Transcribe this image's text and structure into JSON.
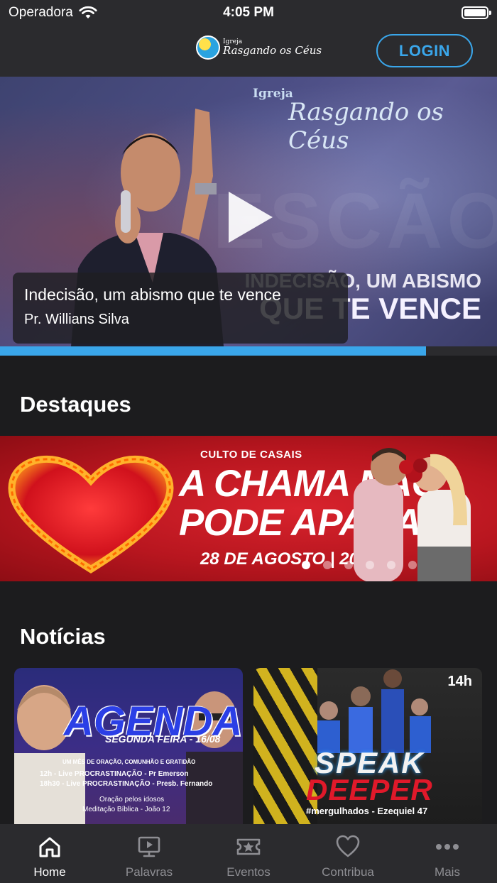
{
  "status_bar": {
    "carrier": "Operadora",
    "time": "4:05 PM"
  },
  "header": {
    "logo_small": "Igreja",
    "logo_script": "Rasgando os Céus",
    "login_label": "LOGIN"
  },
  "hero": {
    "brand_small": "Igreja",
    "brand_script": "Rasgando os Céus",
    "art_line1": "INDECISÃO, UM ABISMO",
    "art_line2": "QUE TE VENCE",
    "caption_title": "Indecisão, um abismo que te vence",
    "caption_subtitle": "Pr. Willians Silva",
    "progress_fraction": 0.857
  },
  "sections": {
    "highlights_title": "Destaques",
    "news_title": "Notícias"
  },
  "banner": {
    "small_text": "CULTO DE CASAIS",
    "big_line1": "A CHAMA NÃO",
    "big_line2": "PODE APAGAR",
    "date": "28 DE AGOSTO | 20h",
    "dots_total": 6,
    "dots_active_index": 0
  },
  "news": [
    {
      "agenda": "AGENDA",
      "date": "SEGUNDA FEIRA - 16/08",
      "subtitle": "UM MÊS DE ORAÇÃO, COMUNHÃO E GRATIDÃO",
      "line1": "12h - Live PROCRASTINAÇÃO - Pr Emerson",
      "line2": "18h30 - Live PROCRASTINAÇÃO - Presb. Fernando",
      "line3": "Oração pelos idosos",
      "line4": "Meditação Bíblica - João 12"
    },
    {
      "time": "14h",
      "word1": "SPEAK",
      "word2": "DEEPER",
      "tag": "#mergulhados - Ezequiel 47"
    }
  ],
  "tabbar": {
    "tabs": [
      {
        "label": "Home",
        "icon": "home-icon",
        "active": true
      },
      {
        "label": "Palavras",
        "icon": "video-icon",
        "active": false
      },
      {
        "label": "Eventos",
        "icon": "ticket-star-icon",
        "active": false
      },
      {
        "label": "Contribua",
        "icon": "heart-icon",
        "active": false
      },
      {
        "label": "Mais",
        "icon": "more-icon",
        "active": false
      }
    ]
  },
  "colors": {
    "accent": "#3aa6ea",
    "background": "#1c1c1e",
    "bar": "#2b2b2e",
    "inactive_tab": "#8e8e93"
  }
}
